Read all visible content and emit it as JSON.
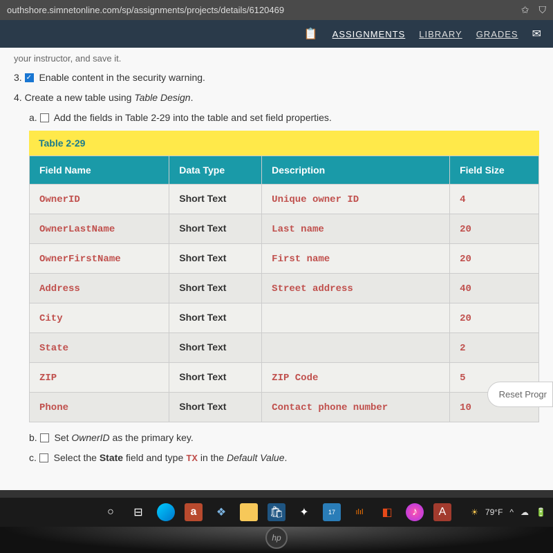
{
  "browser": {
    "url": "outhshore.simnetonline.com/sp/assignments/projects/details/6120469"
  },
  "nav": {
    "assignments": "ASSIGNMENTS",
    "library": "LIBRARY",
    "grades": "GRADES"
  },
  "instructions": {
    "top_fragment": "your instructor, and save it.",
    "step3_num": "3.",
    "step3_text": "Enable content in the security warning.",
    "step4_num": "4.",
    "step4_text_a": "Create a new table using ",
    "step4_text_b": "Table Design",
    "step4_text_c": ".",
    "step4a_num": "a.",
    "step4a_text": "Add the fields in Table 2-29 into the table and set field properties.",
    "table_caption": "Table 2-29",
    "step4b_num": "b.",
    "step4b_a": "Set ",
    "step4b_b": "OwnerID",
    "step4b_c": " as the primary key.",
    "step4c_num": "c.",
    "step4c_a": "Select the ",
    "step4c_b": "State",
    "step4c_c": " field and type ",
    "step4c_d": "TX",
    "step4c_e": " in the ",
    "step4c_f": "Default Value",
    "step4c_g": "."
  },
  "table": {
    "headers": {
      "field_name": "Field Name",
      "data_type": "Data Type",
      "description": "Description",
      "field_size": "Field Size"
    },
    "rows": [
      {
        "field": "OwnerID",
        "type": "Short Text",
        "desc": "Unique owner ID",
        "size": "4"
      },
      {
        "field": "OwnerLastName",
        "type": "Short Text",
        "desc": "Last name",
        "size": "20"
      },
      {
        "field": "OwnerFirstName",
        "type": "Short Text",
        "desc": "First name",
        "size": "20"
      },
      {
        "field": "Address",
        "type": "Short Text",
        "desc": "Street address",
        "size": "40"
      },
      {
        "field": "City",
        "type": "Short Text",
        "desc": "",
        "size": "20"
      },
      {
        "field": "State",
        "type": "Short Text",
        "desc": "",
        "size": "2"
      },
      {
        "field": "ZIP",
        "type": "Short Text",
        "desc": "ZIP Code",
        "size": "5"
      },
      {
        "field": "Phone",
        "type": "Short Text",
        "desc": "Contact phone number",
        "size": "10"
      }
    ]
  },
  "reset_button": "Reset Progr",
  "tray": {
    "weather": "79°F"
  }
}
